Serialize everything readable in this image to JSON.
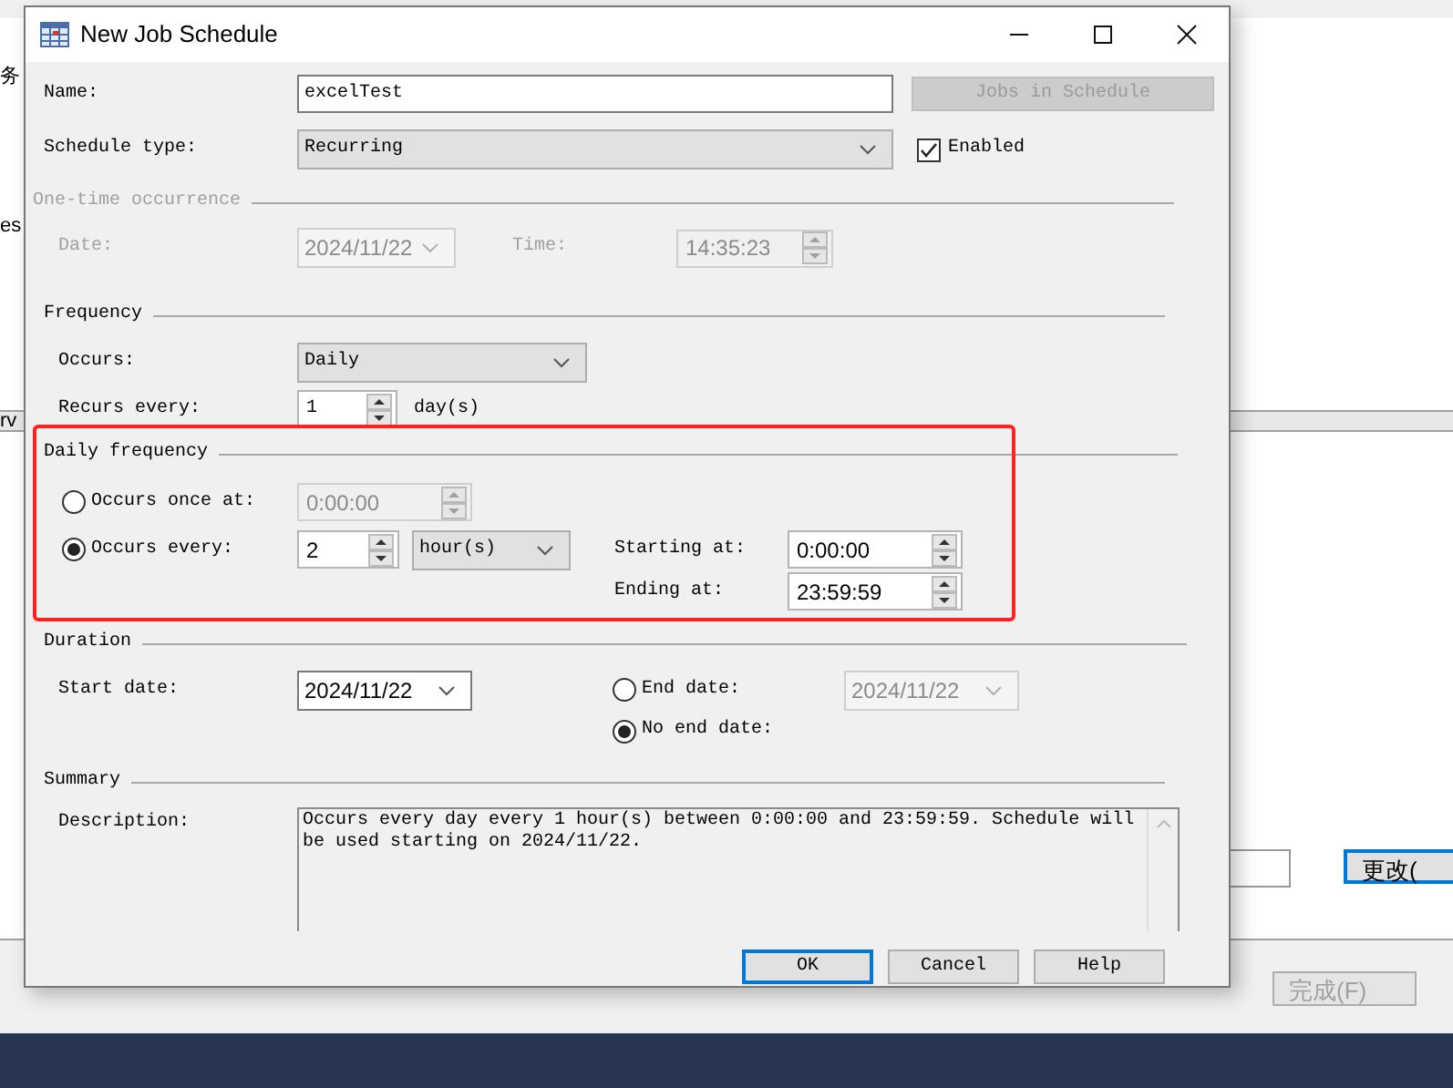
{
  "background": {
    "texts": [
      "务",
      "es",
      "rv"
    ],
    "buttons": [
      {
        "label": "更改(",
        "disabled": false,
        "focused": true
      },
      {
        "label": "完成(F)",
        "disabled": true,
        "focused": false
      }
    ]
  },
  "window": {
    "title": "New Job Schedule"
  },
  "name": {
    "label": "Name:",
    "value": "excelTest"
  },
  "jobs_button": {
    "label": "Jobs in Schedule",
    "disabled": true
  },
  "schedule_type": {
    "label": "Schedule type:",
    "value": "Recurring"
  },
  "enabled": {
    "label": "Enabled",
    "checked": true
  },
  "one_time": {
    "title": "One-time occurrence",
    "disabled": true,
    "date_label": "Date:",
    "date_value": "2024/11/22",
    "time_label": "Time:",
    "time_value": "14:35:23"
  },
  "frequency": {
    "title": "Frequency",
    "occurs_label": "Occurs:",
    "occurs_value": "Daily",
    "recurs_label": "Recurs every:",
    "recurs_value": "1",
    "recurs_unit": "day(s)"
  },
  "daily_frequency": {
    "title": "Daily frequency",
    "options": [
      {
        "label": "Occurs once at:",
        "selected": false
      },
      {
        "label": "Occurs every:",
        "selected": true
      }
    ],
    "once_time": "0:00:00",
    "every_value": "2",
    "every_unit": "hour(s)",
    "starting_label": "Starting at:",
    "starting_value": "0:00:00",
    "ending_label": "Ending at:",
    "ending_value": "23:59:59"
  },
  "duration": {
    "title": "Duration",
    "start_label": "Start date:",
    "start_value": "2024/11/22",
    "end_options": [
      {
        "label": "End date:",
        "selected": false
      },
      {
        "label": "No end date:",
        "selected": true
      }
    ],
    "end_date_value": "2024/11/22"
  },
  "summary": {
    "title": "Summary",
    "description_label": "Description:",
    "description": "Occurs every day every 1 hour(s) between 0:00:00 and 23:59:59. Schedule will be used starting on 2024/11/22."
  },
  "buttons": [
    {
      "label": "OK",
      "focused": true
    },
    {
      "label": "Cancel",
      "focused": false
    },
    {
      "label": "Help",
      "focused": false
    }
  ]
}
